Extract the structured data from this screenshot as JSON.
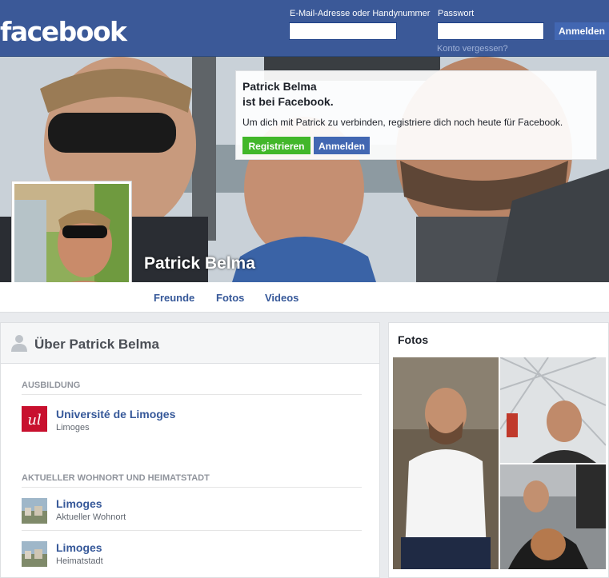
{
  "header": {
    "logo": "facebook",
    "email_label": "E-Mail-Adresse oder Handynummer",
    "password_label": "Passwort",
    "email_value": "",
    "password_value": "",
    "login_button": "Anmelden",
    "forgot_link": "Konto vergessen?"
  },
  "signup_box": {
    "line1": "Patrick Belma",
    "line2": "ist bei Facebook.",
    "message": "Um dich mit Patrick zu verbinden, registriere dich noch heute für Facebook.",
    "register_button": "Registrieren",
    "login_button": "Anmelden"
  },
  "profile": {
    "name": "Patrick Belma"
  },
  "tabs": [
    "Freunde",
    "Fotos",
    "Videos"
  ],
  "about": {
    "title": "Über Patrick Belma",
    "education_label": "AUSBILDUNG",
    "education": {
      "name": "Université de Limoges",
      "sub": "Limoges"
    },
    "residence_label": "AKTUELLER WOHNORT UND HEIMATSTADT",
    "places": [
      {
        "name": "Limoges",
        "sub": "Aktueller Wohnort"
      },
      {
        "name": "Limoges",
        "sub": "Heimatstadt"
      }
    ]
  },
  "photos": {
    "title": "Fotos"
  },
  "colors": {
    "brand": "#3b5998",
    "link": "#365899",
    "green": "#42b72a",
    "button_blue": "#4267b2"
  }
}
